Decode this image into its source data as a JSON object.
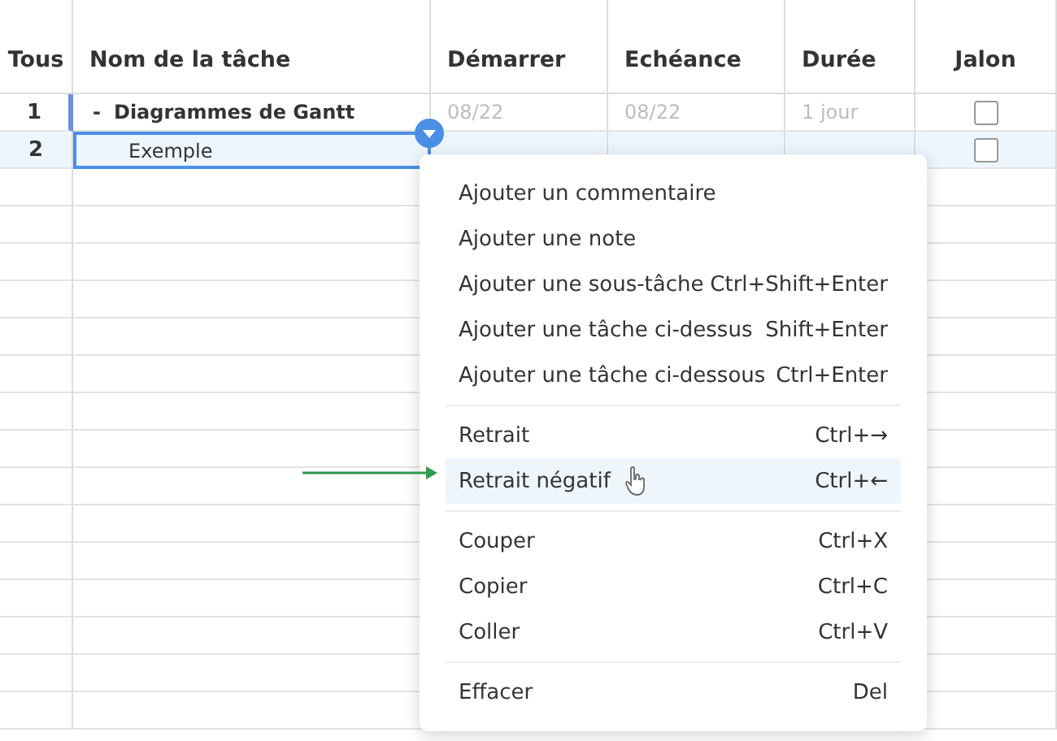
{
  "columns": [
    "Tous",
    "Nom de la tâche",
    "Démarrer",
    "Echéance",
    "Durée",
    "Jalon"
  ],
  "rows": [
    {
      "kind": "parent",
      "number": "1",
      "toggle": "-",
      "name": "Diagrammes de Gantt",
      "start": "08/22",
      "due": "08/22",
      "duration": "1 jour",
      "milestone": false,
      "selected": false
    },
    {
      "kind": "child",
      "number": "2",
      "name": "Exemple",
      "milestone": false,
      "selected": true
    }
  ],
  "context_menu": {
    "groups": [
      [
        {
          "label": "Ajouter un commentaire",
          "selected": false
        },
        {
          "label": "Ajouter une note",
          "selected": false
        },
        {
          "label": "Ajouter une sous-tâche",
          "shortcut": "Ctrl+Shift+Enter",
          "selected": false
        },
        {
          "label": "Ajouter une tâche ci-dessus",
          "shortcut": "Shift+Enter",
          "selected": false
        },
        {
          "label": "Ajouter une tâche ci-dessous",
          "shortcut": "Ctrl+Enter",
          "selected": false
        }
      ],
      [
        {
          "label": "Retrait",
          "shortcut": "Ctrl+→",
          "selected": false
        },
        {
          "label": "Retrait négatif",
          "shortcut": "Ctrl+←",
          "selected": true
        }
      ],
      [
        {
          "label": "Couper",
          "shortcut": "Ctrl+X",
          "selected": false
        },
        {
          "label": "Copier",
          "shortcut": "Ctrl+C",
          "selected": false
        },
        {
          "label": "Coller",
          "shortcut": "Ctrl+V",
          "selected": false
        }
      ],
      [
        {
          "label": "Effacer",
          "shortcut": "Del",
          "selected": false
        }
      ]
    ]
  }
}
